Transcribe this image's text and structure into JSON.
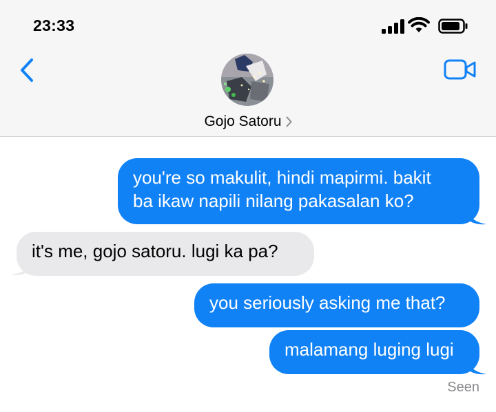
{
  "status_bar": {
    "time": "23:33"
  },
  "conversation": {
    "contact_name": "Gojo Satoru",
    "back_icon": "chevron-left-icon",
    "video_icon": "video-camera-icon",
    "accent_color": "#1182f6"
  },
  "messages": [
    {
      "direction": "outgoing",
      "lines": [
        "you're so makulit, hindi mapirmi. bakit",
        "ba ikaw napili nilang pakasalan ko?"
      ]
    },
    {
      "direction": "incoming",
      "text": "it's me, gojo satoru. lugi ka pa?"
    },
    {
      "direction": "outgoing",
      "text": "you seriously asking me that?"
    },
    {
      "direction": "outgoing",
      "text": "malamang luging lugi"
    }
  ],
  "receipt": {
    "status": "Seen"
  }
}
